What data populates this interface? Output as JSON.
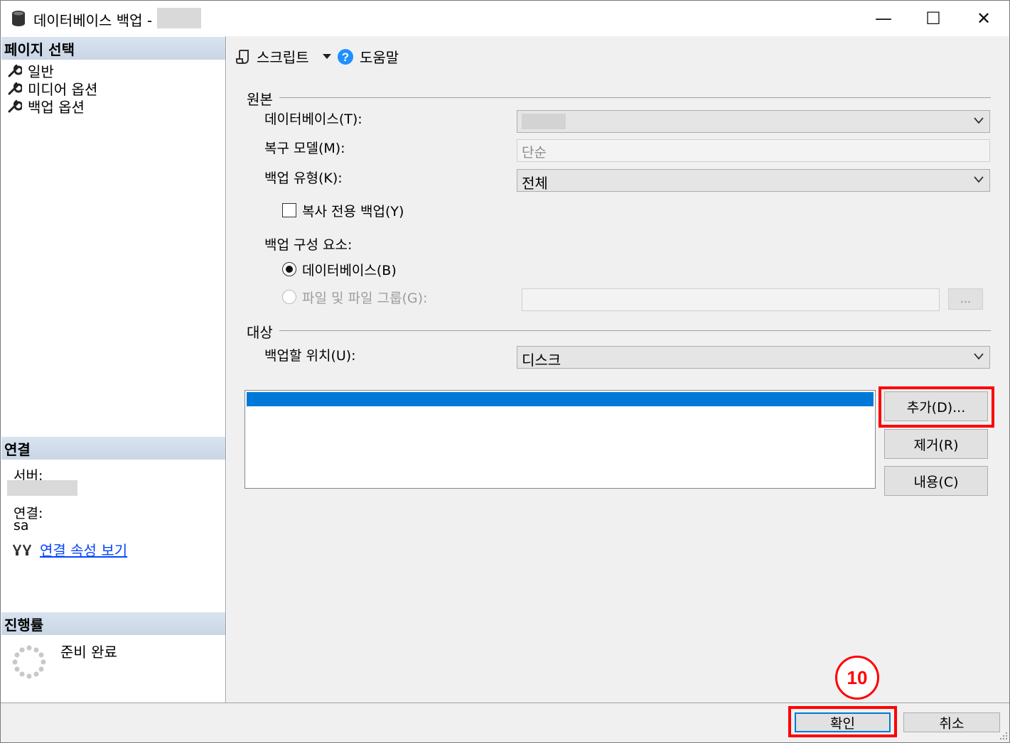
{
  "window": {
    "title": "데이터베이스 백업 -",
    "controls": {
      "minimize": "—",
      "maximize": "☐",
      "close": "✕"
    }
  },
  "left_pane": {
    "page_select": {
      "header": "페이지 선택",
      "items": [
        {
          "label": "일반",
          "icon": "wrench-icon"
        },
        {
          "label": "미디어 옵션",
          "icon": "wrench-icon"
        },
        {
          "label": "백업 옵션",
          "icon": "wrench-icon"
        }
      ]
    },
    "connection": {
      "header": "연결",
      "server_label": "서버:",
      "connection_label": "연결:",
      "connection_value": "sa",
      "view_props_link": "연결 속성 보기"
    },
    "progress": {
      "header": "진행률",
      "status": "준비 완료"
    }
  },
  "toolbar": {
    "script_label": "스크립트",
    "help_label": "도움말"
  },
  "source": {
    "group_title": "원본",
    "database_label": "데이터베이스(T):",
    "recovery_model_label": "복구 모델(M):",
    "recovery_model_value": "단순",
    "backup_type_label": "백업 유형(K):",
    "backup_type_value": "전체",
    "copy_only_label": "복사 전용 백업(Y)",
    "copy_only_checked": false,
    "component_label": "백업 구성 요소:",
    "component_database_label": "데이터베이스(B)",
    "component_files_label": "파일 및 파일 그룹(G):",
    "browse_label": "..."
  },
  "destination": {
    "group_title": "대상",
    "backup_to_label": "백업할 위치(U):",
    "backup_to_value": "디스크",
    "add_button": "추가(D)...",
    "remove_button": "제거(R)",
    "contents_button": "내용(C)"
  },
  "footer": {
    "ok_button": "확인",
    "cancel_button": "취소"
  },
  "annotation": {
    "step_number": "10",
    "highlight_color": "#ff0000"
  }
}
